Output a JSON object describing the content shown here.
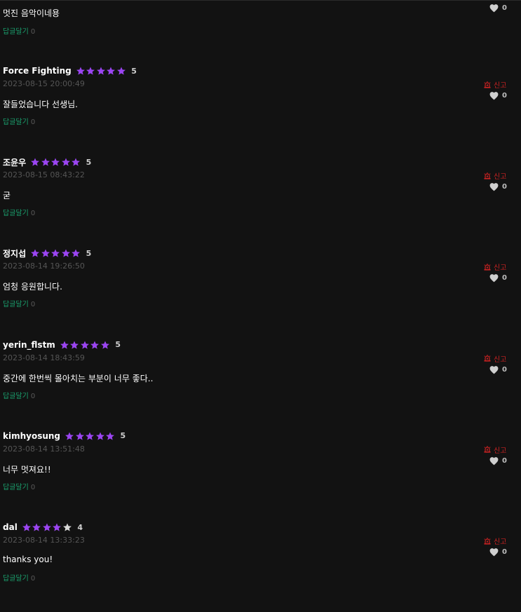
{
  "colors": {
    "background": "#121212",
    "star_filled": "#9b45f2",
    "star_empty": "#d9d9d9",
    "reply_link": "#1aa06d",
    "report": "#cc2222",
    "like_heart": "#cfcfcf",
    "date": "#555555"
  },
  "partial_top_comment": {
    "text": "멋진 음악이네용",
    "reply_label": "답글달기",
    "reply_count": "0",
    "like_count": "0"
  },
  "comments": [
    {
      "username": "Force Fighting",
      "rating": 5,
      "rating_label": "5",
      "date": "2023-08-15 20:00:49",
      "text": "잘들었습니다 선생님.",
      "reply_label": "답글달기",
      "reply_count": "0",
      "report_label": "신고",
      "like_count": "0"
    },
    {
      "username": "조윤우",
      "rating": 5,
      "rating_label": "5",
      "date": "2023-08-15 08:43:22",
      "text": "굳",
      "reply_label": "답글달기",
      "reply_count": "0",
      "report_label": "신고",
      "like_count": "0"
    },
    {
      "username": "정지섭",
      "rating": 5,
      "rating_label": "5",
      "date": "2023-08-14 19:26:50",
      "text": "엄청 응원합니다.",
      "reply_label": "답글달기",
      "reply_count": "0",
      "report_label": "신고",
      "like_count": "0"
    },
    {
      "username": "yerin_flstm",
      "rating": 5,
      "rating_label": "5",
      "date": "2023-08-14 18:43:59",
      "text": "중간에 한번씩 몰아치는 부분이 너무 좋다..",
      "reply_label": "답글달기",
      "reply_count": "0",
      "report_label": "신고",
      "like_count": "0"
    },
    {
      "username": "kimhyosung",
      "rating": 5,
      "rating_label": "5",
      "date": "2023-08-14 13:51:48",
      "text": "너무 멋져요!!",
      "reply_label": "답글달기",
      "reply_count": "0",
      "report_label": "신고",
      "like_count": "0"
    },
    {
      "username": "dal",
      "rating": 4,
      "rating_label": "4",
      "date": "2023-08-14 13:33:23",
      "text": "thanks you!",
      "reply_label": "답글달기",
      "reply_count": "0",
      "report_label": "신고",
      "like_count": "0"
    }
  ],
  "icons": {
    "star": "star-icon",
    "heart": "heart-icon",
    "report": "siren-icon"
  }
}
